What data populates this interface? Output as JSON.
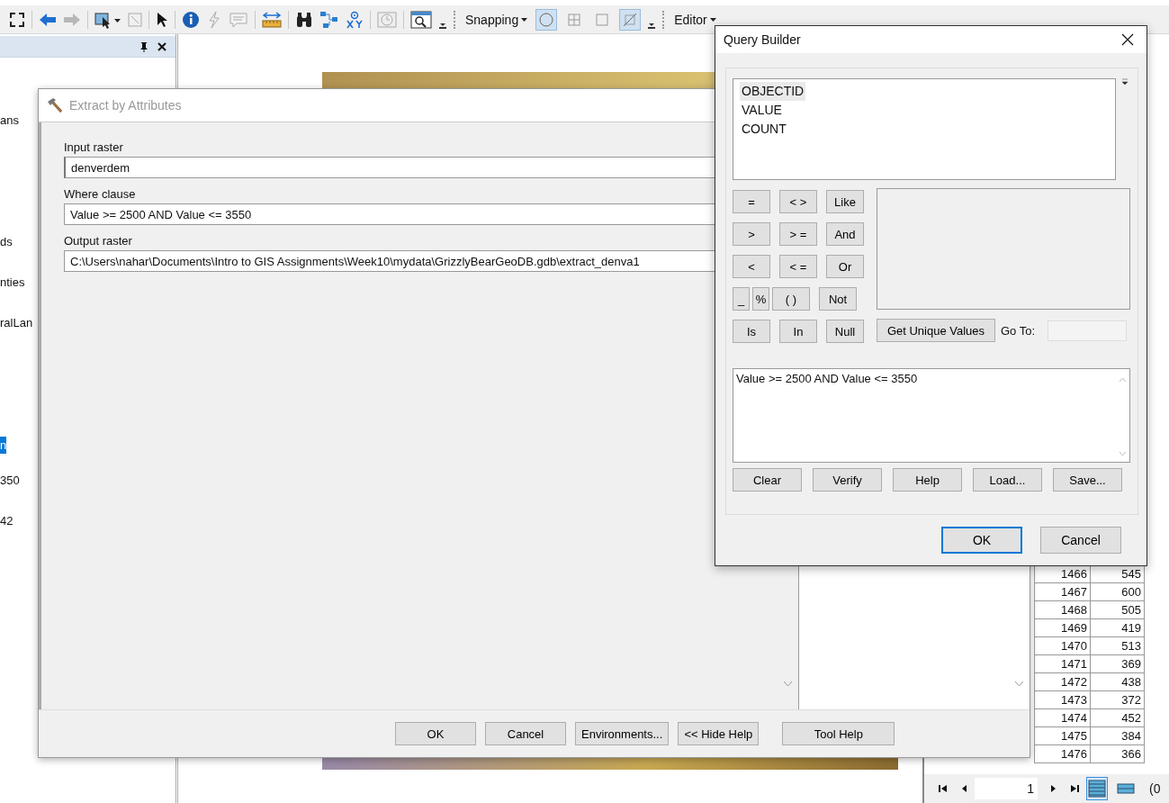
{
  "toolbar": {
    "snapping_label": "Snapping",
    "editor_label": "Editor",
    "snap_toggles": [
      {
        "pressed": true
      },
      {
        "pressed": false
      },
      {
        "pressed": false
      },
      {
        "pressed": true
      }
    ]
  },
  "toc_panel": {
    "items": [
      {
        "label": "ans",
        "selected": false
      },
      {
        "label": "ds",
        "selected": false
      },
      {
        "label": "nties",
        "selected": false
      },
      {
        "label": "ralLan",
        "selected": false
      },
      {
        "label": "n",
        "selected": true
      },
      {
        "label": "350",
        "selected": false
      },
      {
        "label": "42",
        "selected": false
      }
    ]
  },
  "extract_dialog": {
    "title": "Extract by Attributes",
    "fields": [
      {
        "label": "Input raster",
        "value": "denverdem",
        "kind": "dropdown"
      },
      {
        "label": "Where clause",
        "value": "Value >= 2500 AND Value <= 3550",
        "kind": "text"
      },
      {
        "label": "Output raster",
        "value": "C:\\Users\\nahar\\Documents\\Intro to GIS Assignments\\Week10\\mydata\\GrizzlyBearGeoDB.gdb\\extract_denva1",
        "kind": "text"
      }
    ],
    "buttons": [
      "OK",
      "Cancel",
      "Environments...",
      "<< Hide Help"
    ],
    "tool_help_button": "Tool Help"
  },
  "attribute_table": {
    "rows": [
      [
        "1466",
        "545"
      ],
      [
        "1467",
        "600"
      ],
      [
        "1468",
        "505"
      ],
      [
        "1469",
        "419"
      ],
      [
        "1470",
        "513"
      ],
      [
        "1471",
        "369"
      ],
      [
        "1472",
        "438"
      ],
      [
        "1473",
        "372"
      ],
      [
        "1474",
        "452"
      ],
      [
        "1475",
        "384"
      ],
      [
        "1476",
        "366"
      ]
    ],
    "page": "1",
    "views": [
      {
        "selected": true
      },
      {
        "selected": false
      }
    ],
    "status": "(0"
  },
  "query_builder": {
    "title": "Query Builder",
    "fields": [
      {
        "name": "OBJECTID",
        "selected": true
      },
      {
        "name": "VALUE",
        "selected": false
      },
      {
        "name": "COUNT",
        "selected": false
      }
    ],
    "operators": [
      [
        {
          "label": "=",
          "kind": "full"
        },
        {
          "label": "< >",
          "kind": "full"
        },
        {
          "label": "Like",
          "kind": "full"
        }
      ],
      [
        {
          "label": ">",
          "kind": "full"
        },
        {
          "label": "> =",
          "kind": "full"
        },
        {
          "label": "And",
          "kind": "full"
        }
      ],
      [
        {
          "label": "<",
          "kind": "full"
        },
        {
          "label": "< =",
          "kind": "full"
        },
        {
          "label": "Or",
          "kind": "full"
        }
      ],
      [
        {
          "label": "_",
          "kind": "half"
        },
        {
          "label": "%",
          "kind": "half"
        },
        {
          "label": "( )",
          "kind": "full"
        },
        {
          "label": "Not",
          "kind": "full"
        }
      ],
      [
        {
          "label": "Is",
          "kind": "full"
        },
        {
          "label": "In",
          "kind": "full"
        },
        {
          "label": "Null",
          "kind": "full"
        }
      ]
    ],
    "unique_values_button": "Get Unique Values",
    "go_to_label": "Go To:",
    "expression": "Value >= 2500 AND Value <= 3550",
    "action_buttons": [
      "Clear",
      "Verify",
      "Help",
      "Load...",
      "Save..."
    ],
    "buttons": [
      {
        "label": "OK",
        "default": true
      },
      {
        "label": "Cancel",
        "default": false
      }
    ]
  }
}
